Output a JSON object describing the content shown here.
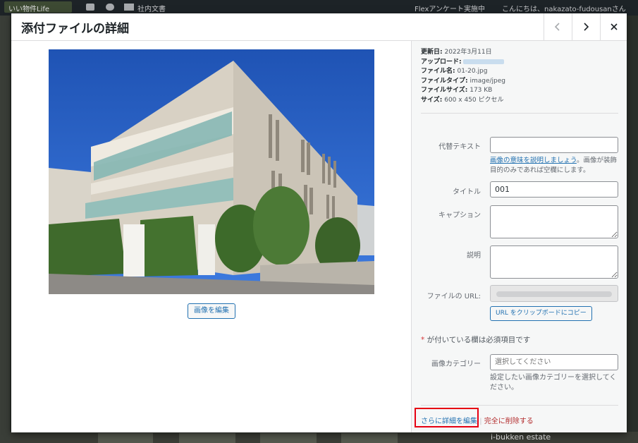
{
  "adminbar": {
    "site_name": "いい物件Life",
    "menu_item": "社内文書",
    "menu_item_2": "Flexアンケート実施中",
    "greeting": "こんにちは、nakazato-fudousanさん"
  },
  "background": {
    "estate_text": "i-bukken estate"
  },
  "modal": {
    "title": "添付ファイルの詳細",
    "edit_image_label": "画像を編集",
    "meta": {
      "updated_label": "更新日:",
      "updated_value": "2022年3月11日",
      "uploaded_label": "アップロード:",
      "filename_label": "ファイル名:",
      "filename_value": "01-20.jpg",
      "filetype_label": "ファイルタイプ:",
      "filetype_value": "image/jpeg",
      "filesize_label": "ファイルサイズ:",
      "filesize_value": "173 KB",
      "size_label": "サイズ:",
      "size_value": "600 x 450 ピクセル"
    },
    "fields": {
      "alt_label": "代替テキスト",
      "alt_value": "",
      "alt_help_link": "画像の意味を説明しましょう",
      "alt_help_text": "。画像が装飾目的のみであれば空欄にします。",
      "title_label": "タイトル",
      "title_value": "001",
      "caption_label": "キャプション",
      "caption_value": "",
      "description_label": "説明",
      "description_value": "",
      "url_label": "ファイルの URL:",
      "copy_url_label": "URL をクリップボードにコピー",
      "required_star": "*",
      "required_text": " が付いている欄は必須項目です",
      "category_label": "画像カテゴリー",
      "category_placeholder": "選択してください",
      "category_help": "設定したい画像カテゴリーを選択してください。"
    },
    "actions": {
      "edit_more": "さらに詳細を編集",
      "separator": "|",
      "delete": "完全に削除する"
    }
  },
  "colors": {
    "link_blue": "#2271b1",
    "delete_red": "#b32d2e",
    "highlight_red": "#e60012"
  }
}
